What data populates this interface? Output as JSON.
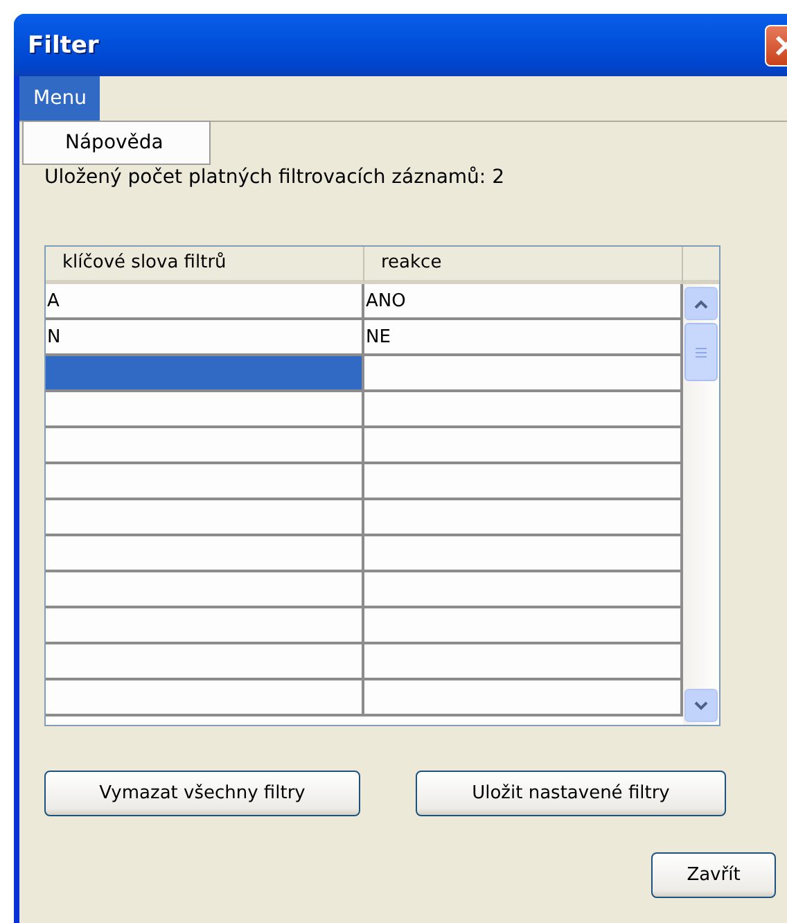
{
  "window": {
    "title": "Filter"
  },
  "menu_bar": [
    {
      "label": "Menu",
      "selected": true
    }
  ],
  "menu_popup": {
    "items": [
      {
        "label": "Nápověda"
      }
    ]
  },
  "count_label": "Uložený počet platných filtrovacích záznamů: 2",
  "table": {
    "columns": [
      "klíčové slova filtrů",
      "reakce"
    ],
    "rows": [
      {
        "keyword": "A",
        "reaction": "ANO",
        "selected": false
      },
      {
        "keyword": "N",
        "reaction": "NE",
        "selected": false
      },
      {
        "selected": true
      },
      {
        "selected": false
      },
      {
        "selected": false
      },
      {
        "selected": false
      },
      {
        "selected": false
      },
      {
        "selected": false
      },
      {
        "selected": false
      },
      {
        "selected": false
      },
      {
        "selected": false
      },
      {
        "selected": false
      }
    ]
  },
  "buttons": [
    "Vymazat všechny filtry",
    "Uložit nastavené filtry"
  ],
  "close_button": "Zavřít"
}
